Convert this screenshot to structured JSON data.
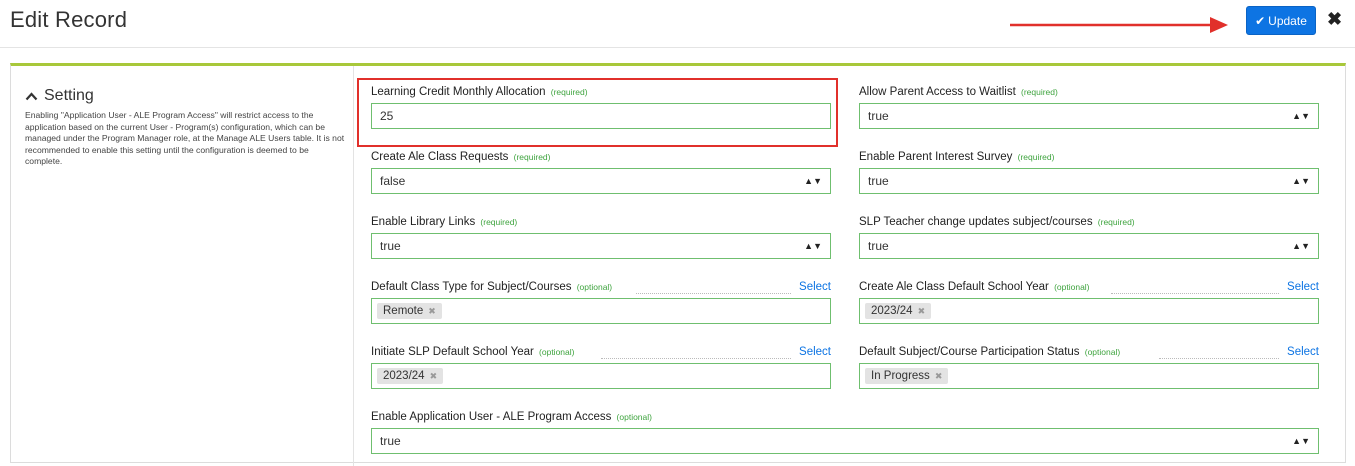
{
  "header": {
    "title": "Edit Record",
    "update_label": "Update",
    "close_label": "✖"
  },
  "setting": {
    "heading": "Setting",
    "description": "Enabling \"Application User - ALE Program Access\" will restrict access to the application based on the current User - Program(s) configuration, which can be managed under the Program Manager role, at the Manage ALE Users table. It is not recommended to enable this setting until the configuration is deemed to be complete."
  },
  "tags": {
    "required": "(required)",
    "optional": "(optional)"
  },
  "select_link": "Select",
  "fields": {
    "learning_credit": {
      "label": "Learning Credit Monthly Allocation",
      "value": "25"
    },
    "allow_parent_access": {
      "label": "Allow Parent Access to Waitlist",
      "value": "true"
    },
    "create_ale_class_requests": {
      "label": "Create Ale Class Requests",
      "value": "false"
    },
    "enable_parent_interest": {
      "label": "Enable Parent Interest Survey",
      "value": "true"
    },
    "enable_library_links": {
      "label": "Enable Library Links",
      "value": "true"
    },
    "slp_teacher_change": {
      "label": "SLP Teacher change updates subject/courses",
      "value": "true"
    },
    "default_class_type": {
      "label": "Default Class Type for Subject/Courses",
      "chip": "Remote"
    },
    "create_ale_default_year": {
      "label": "Create Ale Class Default School Year",
      "chip": "2023/24"
    },
    "initiate_slp_year": {
      "label": "Initiate SLP Default School Year",
      "chip": "2023/24"
    },
    "default_participation": {
      "label": "Default Subject/Course Participation Status",
      "chip": "In Progress"
    },
    "enable_app_user": {
      "label": "Enable Application User - ALE Program Access",
      "value": "true"
    }
  },
  "colors": {
    "accent_blue": "#0d74e3",
    "panel_top": "#a8c83a",
    "required_green": "#3fa43f",
    "highlight_red": "#e1302b"
  }
}
